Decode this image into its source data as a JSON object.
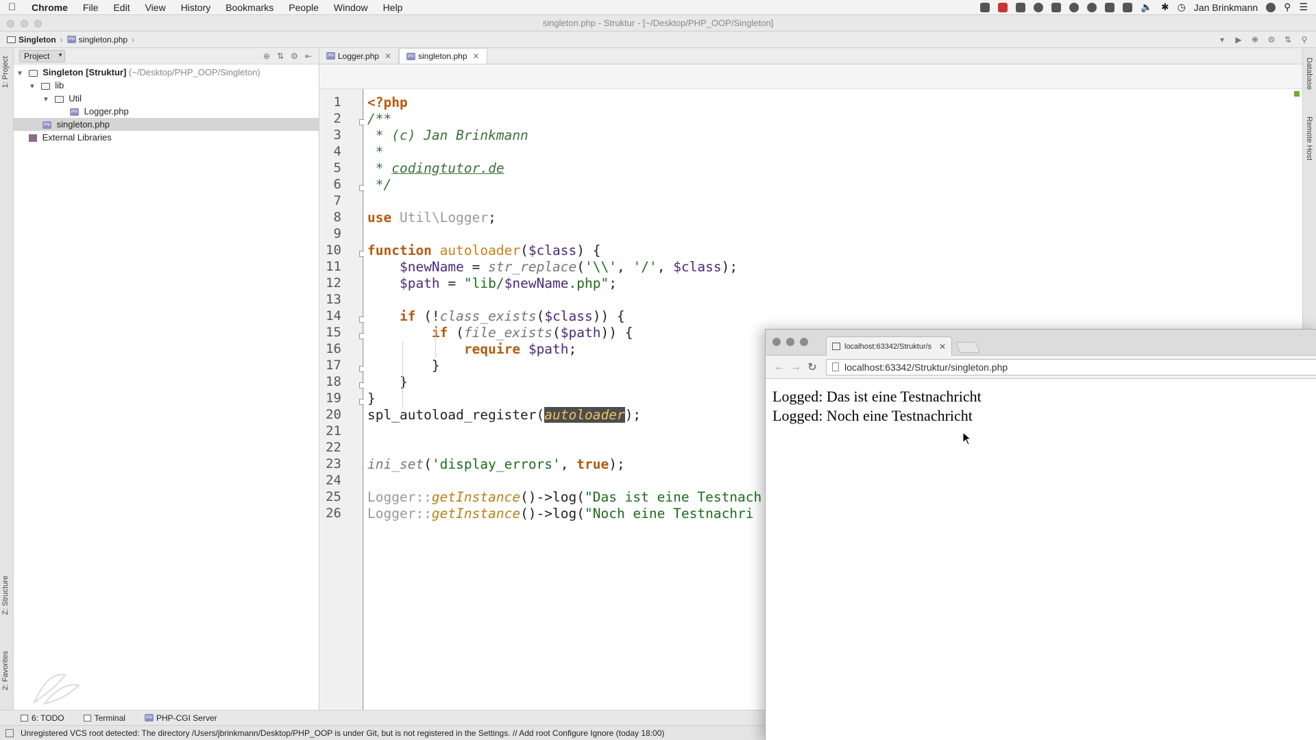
{
  "menubar": {
    "app_name": "Chrome",
    "items": [
      "File",
      "Edit",
      "View",
      "History",
      "Bookmarks",
      "People",
      "Window",
      "Help"
    ],
    "user": "Jan Brinkmann"
  },
  "ide": {
    "window_title": "singleton.php - Struktur - [~/Desktop/PHP_OOP/Singleton]",
    "breadcrumb": [
      "Singleton",
      "singleton.php"
    ],
    "project_panel": {
      "header": "Project",
      "tree": [
        {
          "label": "Singleton [Struktur]",
          "suffix": "(~/Desktop/PHP_OOP/Singleton)",
          "type": "folder",
          "depth": 0,
          "expanded": true
        },
        {
          "label": "lib",
          "type": "folder",
          "depth": 1,
          "expanded": true
        },
        {
          "label": "Util",
          "type": "folder",
          "depth": 2,
          "expanded": true
        },
        {
          "label": "Logger.php",
          "type": "php",
          "depth": 3
        },
        {
          "label": "singleton.php",
          "type": "php",
          "depth": 1,
          "selected": true
        },
        {
          "label": "External Libraries",
          "type": "library",
          "depth": 0
        }
      ]
    },
    "editor_tabs": [
      {
        "label": "Logger.php",
        "active": false
      },
      {
        "label": "singleton.php",
        "active": true
      }
    ],
    "left_tool_tabs": [
      "1: Project",
      "Z: Structure",
      "2: Favorites"
    ],
    "right_tool_tabs": [
      "Database",
      "Remote Host"
    ],
    "bottom_tools": [
      "6: TODO",
      "Terminal",
      "PHP-CGI Server"
    ],
    "status_message": "Unregistered VCS root detected: The directory /Users/jbrinkmann/Desktop/PHP_OOP is under Git, but is not registered in the Settings. // Add root  Configure  Ignore (today 18:00)"
  },
  "code_lines": [
    "<?php",
    "/**",
    " * (c) Jan Brinkmann",
    " *",
    " * codingtutor.de",
    " */",
    "",
    "use Util\\Logger;",
    "",
    "function autoloader($class) {",
    "    $newName = str_replace('\\\\', '/', $class);",
    "    $path = \"lib/$newName.php\";",
    "",
    "    if (!class_exists($class)) {",
    "        if (file_exists($path)) {",
    "            require $path;",
    "        }",
    "    }",
    "}",
    "spl_autoload_register(autoloader);",
    "",
    "",
    "ini_set('display_errors', true);",
    "",
    "Logger::getInstance()->log(\"Das ist eine Testnach",
    "Logger::getInstance()->log(\"Noch eine Testnachri"
  ],
  "browser": {
    "tab_title": "localhost:63342/Struktur/s",
    "url": "localhost:63342/Struktur/singleton.php",
    "content_lines": [
      "Logged: Das ist eine Testnachricht",
      "Logged: Noch eine Testnachricht"
    ]
  }
}
